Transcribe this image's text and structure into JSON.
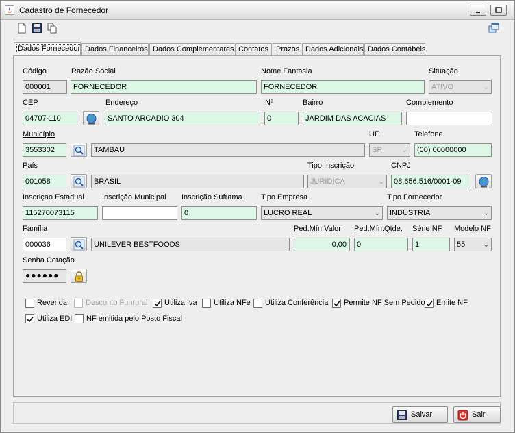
{
  "window": {
    "title": "Cadastro de Fornecedor"
  },
  "tabs": [
    {
      "label": "Dados Fornecedor"
    },
    {
      "label": "Dados Financeiros"
    },
    {
      "label": "Dados Complementares"
    },
    {
      "label": "Contatos"
    },
    {
      "label": "Prazos"
    },
    {
      "label": "Dados Adicionais"
    },
    {
      "label": "Dados Contábeis"
    }
  ],
  "form": {
    "codigo": {
      "label": "Código",
      "value": "000001"
    },
    "razao_social": {
      "label": "Razão Social",
      "value": "FORNECEDOR"
    },
    "nome_fantasia": {
      "label": "Nome Fantasia",
      "value": "FORNECEDOR"
    },
    "situacao": {
      "label": "Situação",
      "value": "ATIVO"
    },
    "cep": {
      "label": "CEP",
      "value": "04707-110"
    },
    "endereco": {
      "label": "Endereço",
      "value": "SANTO ARCADIO 304"
    },
    "numero": {
      "label": "Nº",
      "value": "0"
    },
    "bairro": {
      "label": "Bairro",
      "value": "JARDIM DAS ACACIAS"
    },
    "complemento": {
      "label": "Complemento",
      "value": ""
    },
    "municipio": {
      "label": "Município",
      "code": "3553302",
      "name": "TAMBAU"
    },
    "uf": {
      "label": "UF",
      "value": "SP"
    },
    "telefone": {
      "label": "Telefone",
      "value": "(00) 00000000"
    },
    "pais": {
      "label": "País",
      "code": "001058",
      "name": "BRASIL"
    },
    "tipo_inscricao": {
      "label": "Tipo Inscrição",
      "value": "JURIDICA"
    },
    "cnpj": {
      "label": "CNPJ",
      "value": "08.656.516/0001-09"
    },
    "inscricao_estadual": {
      "label": "Inscriçao Estadual",
      "value": "115270073115"
    },
    "inscricao_municipal": {
      "label": "Inscrição Municipal",
      "value": ""
    },
    "inscricao_suframa": {
      "label": "Inscrição Suframa",
      "value": "0"
    },
    "tipo_empresa": {
      "label": "Tipo Empresa",
      "value": "LUCRO REAL"
    },
    "tipo_fornecedor": {
      "label": "Tipo Fornecedor",
      "value": "INDUSTRIA"
    },
    "familia": {
      "label": "Família",
      "code": "000036",
      "name": "UNILEVER BESTFOODS"
    },
    "ped_min_valor": {
      "label": "Ped.Mín.Valor",
      "value": "0,00"
    },
    "ped_min_qtde": {
      "label": "Ped.Mín.Qtde.",
      "value": "0"
    },
    "serie_nf": {
      "label": "Série NF",
      "value": "1"
    },
    "modelo_nf": {
      "label": "Modelo NF",
      "value": "55"
    },
    "senha_cotacao": {
      "label": "Senha Cotação",
      "value": "●●●●●●"
    }
  },
  "checkboxes": [
    {
      "label": "Revenda",
      "checked": false,
      "enabled": true
    },
    {
      "label": "Desconto Funrural",
      "checked": false,
      "enabled": false
    },
    {
      "label": "Utiliza Iva",
      "checked": true,
      "enabled": true
    },
    {
      "label": "Utiliza NFe",
      "checked": false,
      "enabled": true
    },
    {
      "label": "Utiliza Conferência",
      "checked": false,
      "enabled": true
    },
    {
      "label": "Permite NF Sem Pedido",
      "checked": true,
      "enabled": true
    },
    {
      "label": "Emite NF",
      "checked": true,
      "enabled": true
    },
    {
      "label": "Utiliza EDI",
      "checked": true,
      "enabled": true
    },
    {
      "label": "NF emitida pelo Posto Fiscal",
      "checked": false,
      "enabled": true
    }
  ],
  "buttons": {
    "salvar": "Salvar",
    "sair": "Sair"
  },
  "icons": {
    "new": "new-document-icon",
    "save": "floppy-disk-icon",
    "copy": "copy-icon",
    "search": "magnifier-icon",
    "globe": "globe-icon",
    "lock": "padlock-icon",
    "exit": "power-icon"
  },
  "colors": {
    "field_green": "#dcf7e6",
    "field_disabled": "#e6e6e6",
    "window_bg": "#eeeeee"
  }
}
